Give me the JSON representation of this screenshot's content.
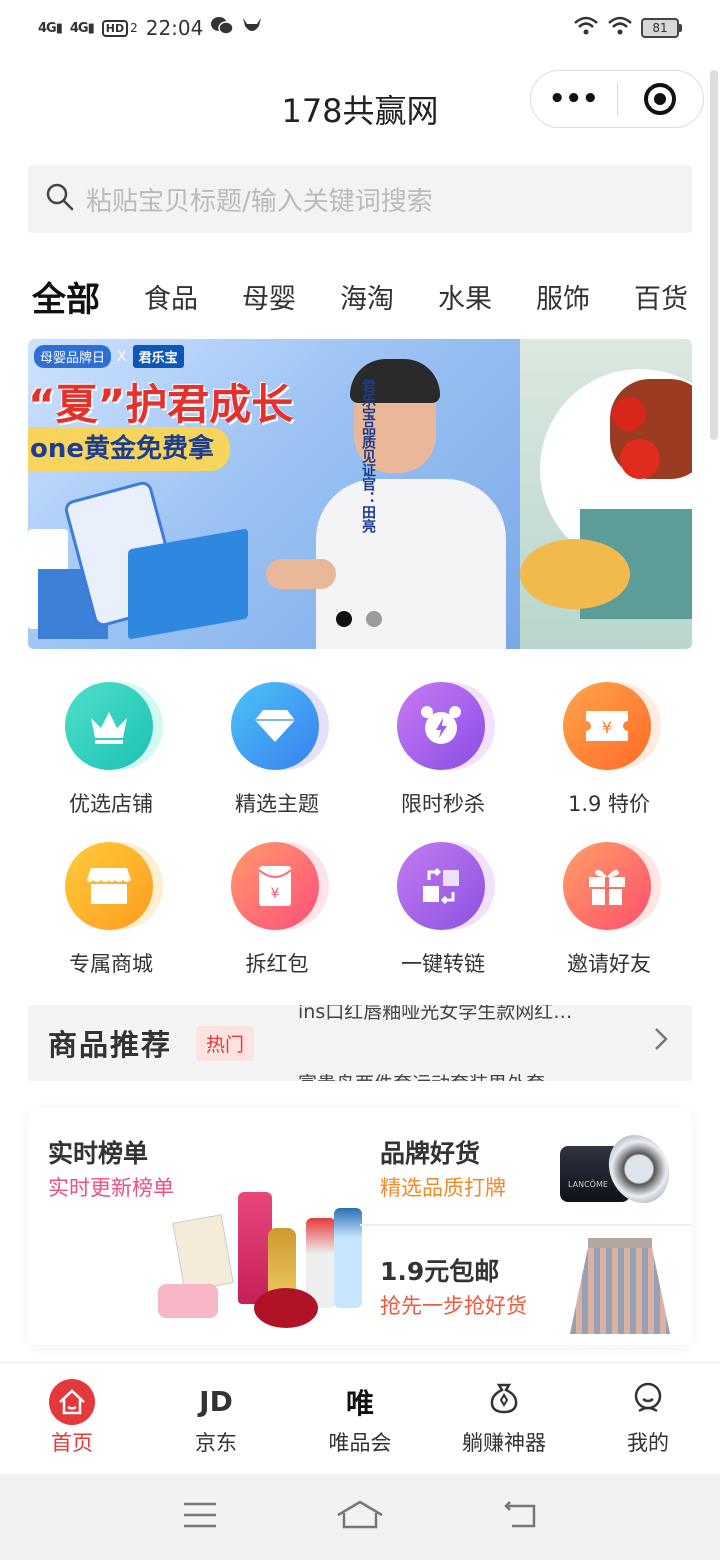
{
  "status_bar": {
    "net1": "4G",
    "net2": "4G",
    "hd": "HD",
    "hd_sub": "2",
    "time": "22:04",
    "battery": "81"
  },
  "titlebar": {
    "title": "178共赢网",
    "more_icon": "•••"
  },
  "search": {
    "placeholder": "粘贴宝贝标题/输入关键词搜索"
  },
  "categories": [
    "全部",
    "食品",
    "母婴",
    "海淘",
    "水果",
    "服饰",
    "百货"
  ],
  "banner": {
    "logo1": "母婴品牌日",
    "x_mark": "X",
    "logo2": "君乐宝",
    "headline": "“夏”护君成长",
    "subline": "one黄金免费拿",
    "vertical_text": "君乐宝品质见证官：田亮",
    "active_slide": 0,
    "slide_count": 2
  },
  "grid_items": [
    {
      "label": "优选店铺",
      "icon": "crown-icon",
      "color": "#1cc0b5"
    },
    {
      "label": "精选主题",
      "icon": "diamond-icon",
      "color": "#3a7ff0"
    },
    {
      "label": "限时秒杀",
      "icon": "alarm-clock-icon",
      "color": "#8a4de6"
    },
    {
      "label": "1.9 特价",
      "icon": "yen-ticket-icon",
      "color": "#ff6a28"
    },
    {
      "label": "专属商城",
      "icon": "shop-icon",
      "color": "#ff9c1f"
    },
    {
      "label": "拆红包",
      "icon": "red-envelope-icon",
      "color": "#ff4f7b"
    },
    {
      "label": "一键转链",
      "icon": "convert-link-icon",
      "color": "#8d50e2"
    },
    {
      "label": "邀请好友",
      "icon": "gift-icon",
      "color": "#ff4f6d"
    }
  ],
  "recommend": {
    "title": "商品推荐",
    "tag": "热门",
    "line1": "ins口红唇釉哑光女学生款网红…",
    "line2": "富贵鸟两件套运动套装男外套"
  },
  "promo": {
    "left": {
      "title": "实时榜单",
      "subtitle": "实时更新榜单"
    },
    "right_top": {
      "title": "品牌好货",
      "subtitle": "精选品质打牌",
      "product_text": "LANCÔME"
    },
    "right_bottom": {
      "title": "1.9元包邮",
      "subtitle": "抢先一步抢好货"
    }
  },
  "tabbar": [
    {
      "label": "首页",
      "icon_text": "",
      "icon": "home-icon",
      "active": true
    },
    {
      "label": "京东",
      "icon_text": "JD",
      "icon": "jd-icon",
      "active": false
    },
    {
      "label": "唯品会",
      "icon_text": "唯",
      "icon": "vip-icon",
      "active": false
    },
    {
      "label": "躺赚神器",
      "icon_text": "",
      "icon": "money-bag-icon",
      "active": false
    },
    {
      "label": "我的",
      "icon_text": "",
      "icon": "profile-icon",
      "active": false
    }
  ],
  "colors": {
    "accent": "#e4393c",
    "pink": "#ee4f87",
    "orange": "#f28a2c"
  }
}
